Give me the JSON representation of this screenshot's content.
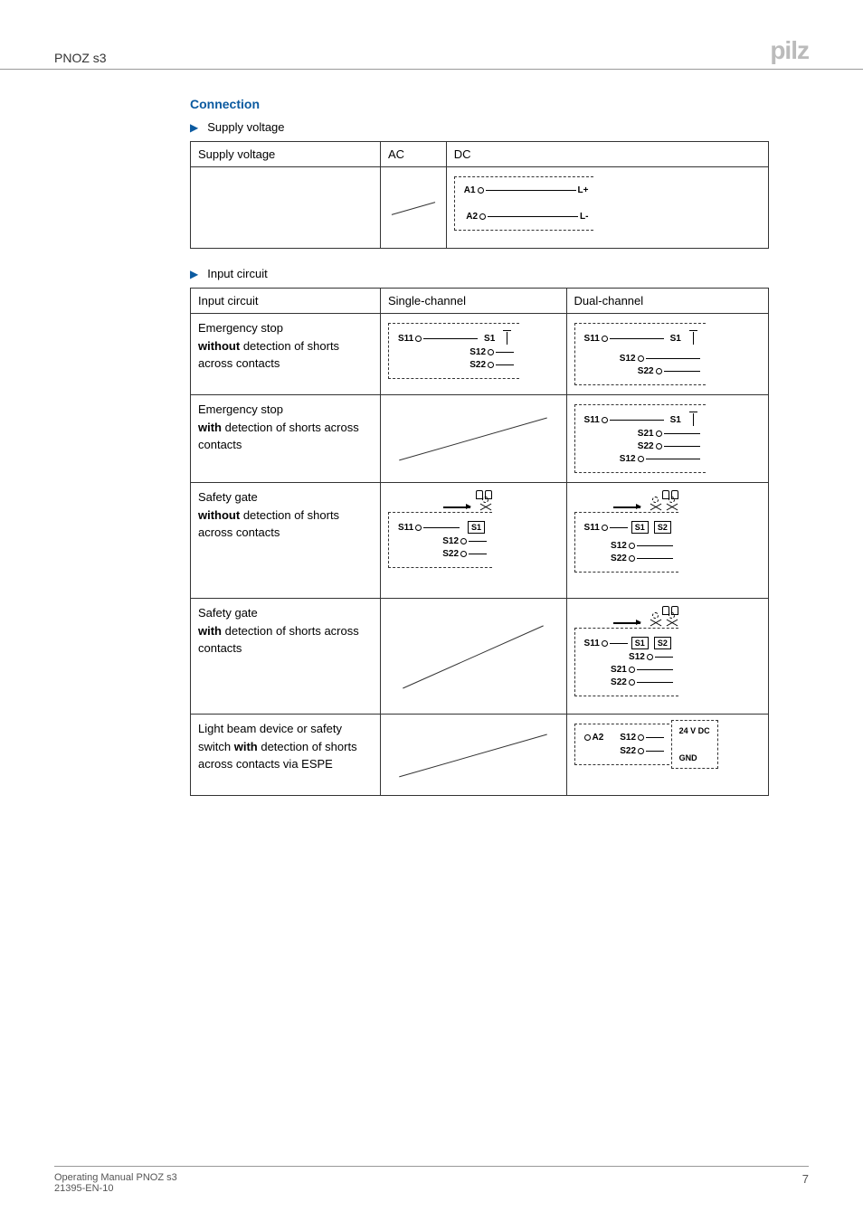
{
  "header": {
    "product": "PNOZ s3",
    "brand": "pilz"
  },
  "connection": {
    "heading": "Connection",
    "supply_bullet": "Supply voltage",
    "input_bullet": "Input circuit",
    "supply_table": {
      "head": {
        "c1": "Supply voltage",
        "c2": "AC",
        "c3": "DC"
      },
      "dc": {
        "t1": "A1",
        "t2": "A2",
        "p1": "L+",
        "p2": "L-"
      }
    },
    "input_table": {
      "head": {
        "c1": "Input circuit",
        "c2": "Single-channel",
        "c3": "Dual-channel"
      },
      "rows": [
        {
          "title": "Emergency stop",
          "bold": "without",
          "rest": " detection of shorts across contacts"
        },
        {
          "title": "Emergency stop",
          "bold": "with",
          "rest": " detection of shorts across contacts"
        },
        {
          "title": "Safety gate",
          "bold": "without",
          "rest": " detection of shorts across contacts"
        },
        {
          "title": "Safety gate",
          "bold": "with",
          "rest": " detection of shorts across contacts"
        },
        {
          "title": "Light beam device or safety switch ",
          "bold": "with",
          "rest": " detection of shorts across contacts via ESPE"
        }
      ],
      "labels": {
        "S1": "S1",
        "S2": "S2",
        "S11": "S11",
        "S12": "S12",
        "S21": "S21",
        "S22": "S22",
        "A2": "A2",
        "V24": "24 V DC",
        "GND": "GND"
      }
    }
  },
  "footer": {
    "line1": "Operating Manual PNOZ s3",
    "line2": "21395-EN-10",
    "page": "7"
  }
}
